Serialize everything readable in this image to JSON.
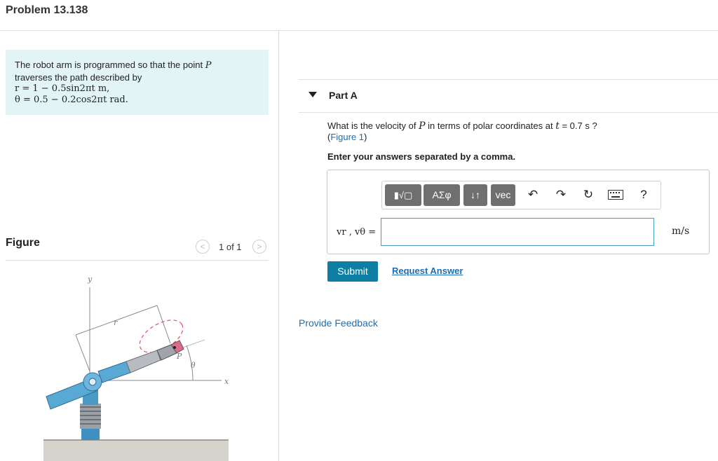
{
  "problem": {
    "title": "Problem 13.138"
  },
  "statement": {
    "line1_text": "The robot arm is programmed so that the point ",
    "line1_var": "P",
    "line2": "traverses the path described by",
    "eq_r": "r = 1 − 0.5sin2πt m,",
    "eq_theta": "θ = 0.5 − 0.2cos2πt rad."
  },
  "figure": {
    "label": "Figure",
    "pager_text": "1 of 1",
    "prev_icon": "chevron-left-icon",
    "next_icon": "chevron-right-icon",
    "labels": {
      "y": "y",
      "r": "r",
      "p": "P",
      "theta": "θ",
      "x": "x"
    }
  },
  "part_a": {
    "title": "Part A",
    "question_pre": "What is the velocity of ",
    "question_var": "P",
    "question_mid": " in terms of polar coordinates at ",
    "question_t": "t",
    "question_post": " = 0.7 s ?",
    "figure_link_open": "(",
    "figure_link": "Figure 1",
    "figure_link_close": ")",
    "instruction": "Enter your answers separated by a comma.",
    "toolbar": {
      "templates": "▮√▢",
      "symbols": "ΑΣφ",
      "arrows": "↓↑",
      "vec": "vec",
      "undo_icon": "undo-icon",
      "redo_icon": "redo-icon",
      "reset_icon": "reset-icon",
      "keyboard_icon": "keyboard-icon",
      "help": "?"
    },
    "answer_label": "vr , vθ =",
    "answer_value": "",
    "unit": "m/s",
    "submit": "Submit",
    "request_answer": "Request Answer"
  },
  "feedback": "Provide Feedback",
  "colors": {
    "accent": "#0f7ea5",
    "link": "#1a6eb5",
    "statement_bg": "#e3f4f7"
  }
}
